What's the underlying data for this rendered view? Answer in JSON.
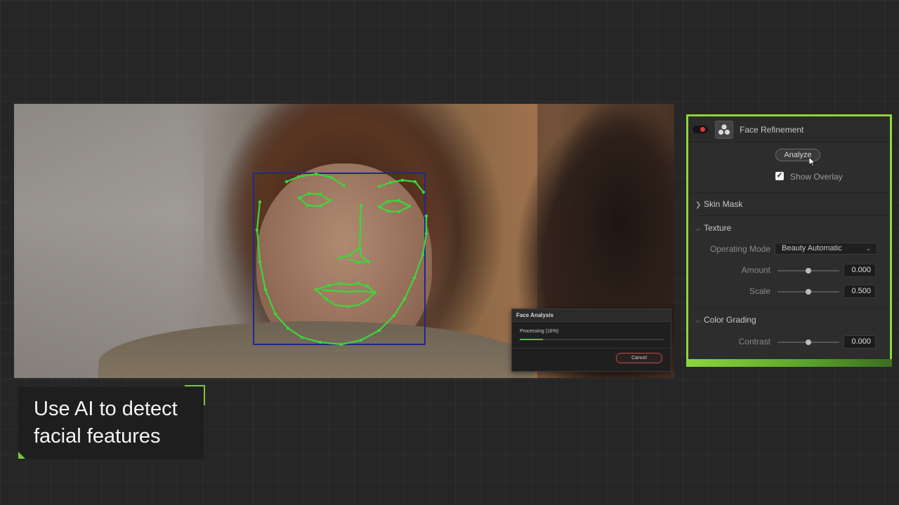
{
  "dialog": {
    "title": "Face Analysis",
    "status": "Processing (16%)",
    "progress_percent": 16,
    "cancel_label": "Cancel"
  },
  "panel": {
    "title": "Face Refinement",
    "analyze_label": "Analyze",
    "show_overlay_label": "Show Overlay",
    "show_overlay_checked": true,
    "sections": {
      "skin_mask": "Skin Mask",
      "texture": "Texture",
      "color_grading": "Color Grading"
    },
    "texture": {
      "operating_mode_label": "Operating Mode",
      "operating_mode_value": "Beauty Automatic",
      "amount_label": "Amount",
      "amount_value": "0.000",
      "scale_label": "Scale",
      "scale_value": "0.500"
    },
    "color_grading": {
      "contrast_label": "Contrast",
      "contrast_value": "0.000"
    },
    "accent_color": "#8ed63b"
  },
  "caption": {
    "line1": "Use AI to detect",
    "line2": "facial features"
  },
  "overlay_color": "#3dd63d",
  "face_box_color": "#1d2a8c"
}
